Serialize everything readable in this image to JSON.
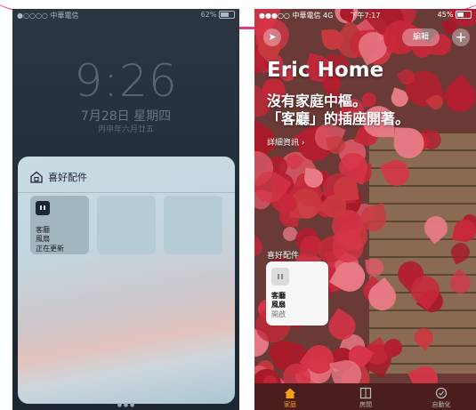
{
  "lock_screen": {
    "status": {
      "carrier": "●○○○○ 中華電信",
      "battery": "62%"
    },
    "time": "9:26",
    "date": "7月28日 星期四",
    "lunar": "丙申年六月廿五",
    "widget": {
      "title": "喜好配件",
      "tile": {
        "name_line1": "客廳",
        "name_line2": "風扇",
        "status": "正在更新"
      }
    },
    "page_dots": "● ● ●"
  },
  "home_app": {
    "status": {
      "carrier": "●●●○○ 中華電信 4G",
      "time": "下午7:17",
      "battery": "45%"
    },
    "location_icon": "➤",
    "edit_label": "編輯",
    "add_icon": "+",
    "title": "Eric Home",
    "subtitle_line1": "沒有家庭中樞。",
    "subtitle_line2": "「客廳」的插座開著。",
    "details_link": "詳細資訊 ›",
    "favorites_label": "喜好配件",
    "accessory": {
      "name_line1": "客廳",
      "name_line2": "風扇",
      "status": "開啟"
    },
    "tabs": [
      {
        "label": "家庭"
      },
      {
        "label": "房間"
      },
      {
        "label": "自動化"
      }
    ]
  }
}
